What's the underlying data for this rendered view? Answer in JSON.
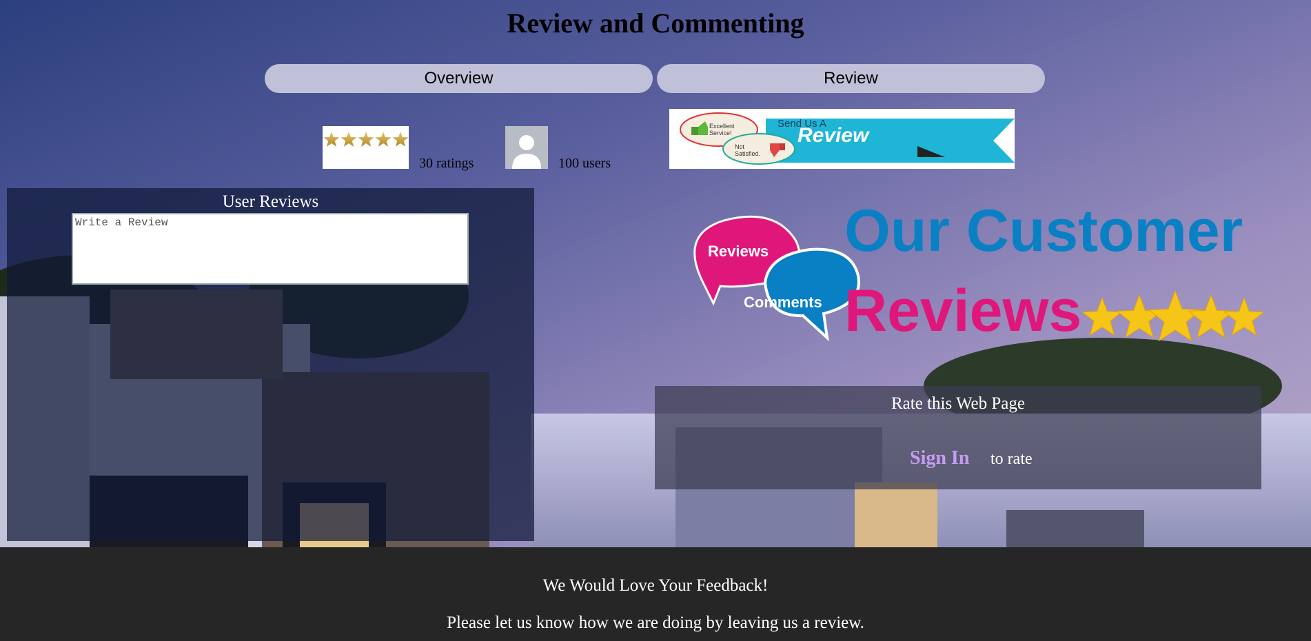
{
  "page": {
    "title": "Review and Commenting"
  },
  "tabs": [
    {
      "label": "Overview"
    },
    {
      "label": "Review"
    }
  ],
  "summary": {
    "ratings_text": "30 ratings",
    "users_text": "100 users",
    "star_rating": 5,
    "star_max": 5
  },
  "review_banner": {
    "send_us_a": "Send Us A",
    "review": "Review",
    "bubble_good": "Excellent Service!",
    "bubble_bad": "Not Satisfied."
  },
  "user_reviews": {
    "heading": "User Reviews",
    "placeholder": "Write a Review"
  },
  "customer_graphic": {
    "bubble_reviews": "Reviews",
    "bubble_comments": "Comments",
    "line1": "Our Customer",
    "line2": "Reviews",
    "stars": 5,
    "colors": {
      "blue": "#0a80c4",
      "pink": "#e0177a",
      "gold": "#f5c518"
    }
  },
  "rate": {
    "heading": "Rate this Web Page",
    "signin": "Sign In",
    "suffix": "to rate"
  },
  "footer": {
    "line1": "We Would Love Your Feedback!",
    "line2": "Please let us know how we are doing by leaving us a review."
  },
  "icons": {
    "stars_image": "five-star-rating-icon",
    "avatar": "user-avatar-icon",
    "thumbs_up": "thumbs-up-icon",
    "thumbs_down": "thumbs-down-icon"
  }
}
